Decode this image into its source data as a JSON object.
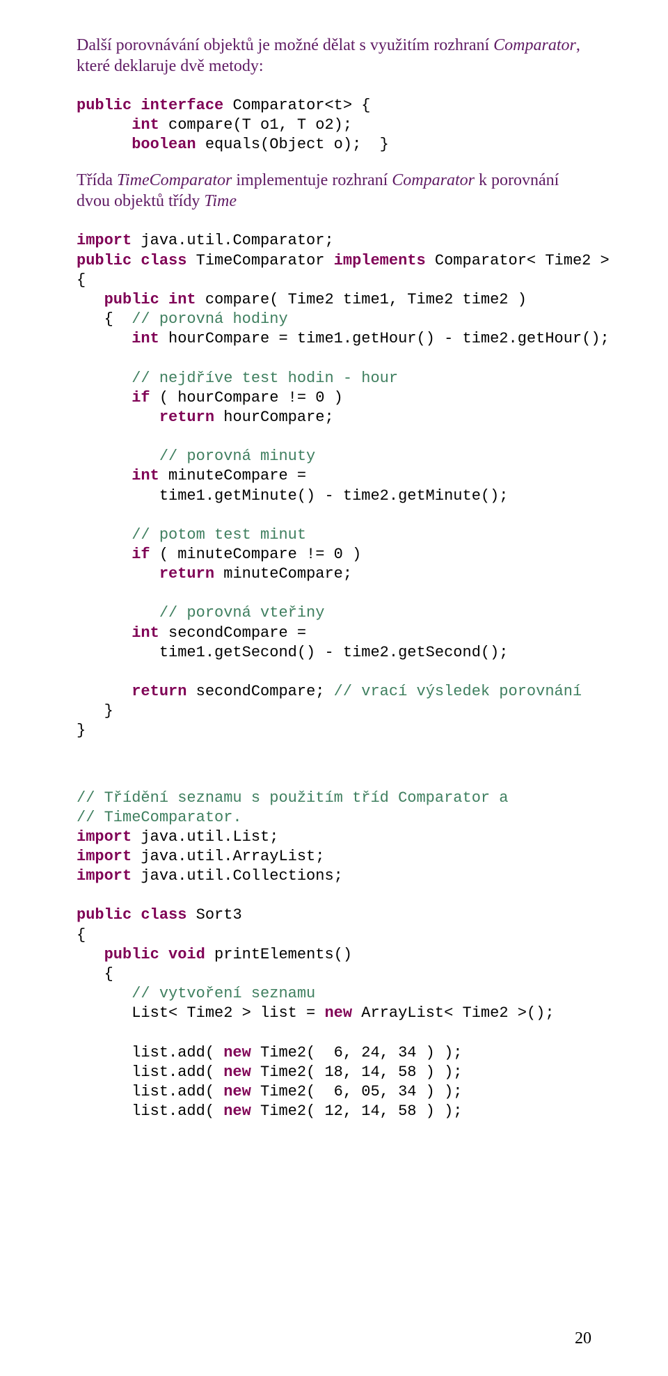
{
  "intro": {
    "p1a": "Další porovnávání objektů je možné dělat s využitím rozhraní ",
    "p1b": "Comparator",
    "p1c": ", které deklaruje dvě metody:"
  },
  "code1": {
    "l1a": "public",
    "l1b": " interface",
    "l1c": " Comparator<t> {",
    "l2a": "      int",
    "l2b": " compare(T o1, T o2);",
    "l3a": "      boolean",
    "l3b": " equals(Object o);  }"
  },
  "intro2": {
    "p1a": "Třída ",
    "p1b": "TimeComparator",
    "p1c": " implementuje rozhraní ",
    "p1d": "Comparator",
    "p1e": " k porovnání dvou objektů třídy ",
    "p1f": "Time"
  },
  "code2": {
    "l1a": "import",
    "l1b": " java.util.Comparator;",
    "l2a": "public",
    "l2b": " class",
    "l2c": " TimeComparator ",
    "l2d": "implements",
    "l2e": " Comparator< Time2 >",
    "l3": "{",
    "l4a": "   public",
    "l4b": " int",
    "l4c": " compare( Time2 time1, Time2 time2 )",
    "l5a": "   {  ",
    "l5b": "// porovná hodiny",
    "l6a": "      int",
    "l6b": " hourCompare = time1.getHour() - time2.getHour();",
    "l7a": "      // nejdříve test hodin - hour",
    "l8a": "      if",
    "l8b": " ( hourCompare != 0 )",
    "l9a": "         return",
    "l9b": " hourCompare;",
    "l10a": "         // porovná minuty",
    "l11a": "      int",
    "l11b": " minuteCompare =",
    "l12": "         time1.getMinute() - time2.getMinute();",
    "l13a": "      // potom test minut",
    "l14a": "      if",
    "l14b": " ( minuteCompare != 0 )",
    "l15a": "         return",
    "l15b": " minuteCompare;",
    "l16a": "         // porovná vteřiny",
    "l17a": "      int",
    "l17b": " secondCompare =",
    "l18": "         time1.getSecond() - time2.getSecond();",
    "l19a": "      return",
    "l19b": " secondCompare; ",
    "l19c": "// vrací výsledek porovnání",
    "l20": "   }",
    "l21": "}"
  },
  "code3": {
    "l1": "// Třídění seznamu s použitím tříd Comparator a",
    "l2": "// TimeComparator.",
    "l3a": "import",
    "l3b": " java.util.List;",
    "l4a": "import",
    "l4b": " java.util.ArrayList;",
    "l5a": "import",
    "l5b": " java.util.Collections;",
    "l6a": "public",
    "l6b": " class",
    "l6c": " Sort3",
    "l7": "{",
    "l8a": "   public",
    "l8b": " void",
    "l8c": " printElements()",
    "l9": "   {",
    "l10a": "      // vytvoření seznamu",
    "l11a": "      List< Time2 > list = ",
    "l11b": "new",
    "l11c": " ArrayList< Time2 >();",
    "l12a": "      list.add( ",
    "l12b": "new",
    "l12c": " Time2(  6, 24, 34 ) );",
    "l13a": "      list.add( ",
    "l13b": "new",
    "l13c": " Time2( 18, 14, 58 ) );",
    "l14a": "      list.add( ",
    "l14b": "new",
    "l14c": " Time2(  6, 05, 34 ) );",
    "l15a": "      list.add( ",
    "l15b": "new",
    "l15c": " Time2( 12, 14, 58 ) );"
  },
  "page_number": "20"
}
